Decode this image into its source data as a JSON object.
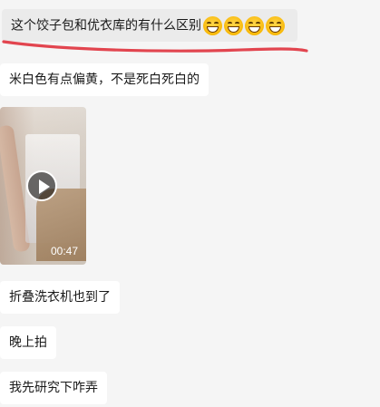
{
  "messages": [
    {
      "text": "这个饺子包和优衣库的有什么区别",
      "emoji": "grinning-squinting-face-emoji"
    },
    {
      "text": "米白色有点偏黄，不是死白死白的"
    },
    {
      "video_duration": "00:47"
    },
    {
      "text": "折叠洗衣机也到了"
    },
    {
      "text": "晚上拍"
    },
    {
      "text": "我先研究下咋弄"
    }
  ],
  "colors": {
    "background": "#f5f5f5",
    "bubble": "#ffffff",
    "highlight_bubble": "#ebebeb",
    "annotation_underline": "#e2454f"
  }
}
